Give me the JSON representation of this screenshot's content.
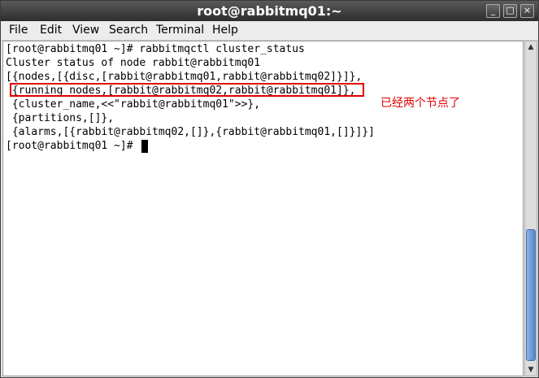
{
  "window": {
    "title": "root@rabbitmq01:~",
    "minimize_glyph": "_",
    "maximize_glyph": "□",
    "close_glyph": "×"
  },
  "menu": {
    "items": [
      "File",
      "Edit",
      "View",
      "Search",
      "Terminal",
      "Help"
    ]
  },
  "terminal": {
    "lines": [
      "[root@rabbitmq01 ~]# rabbitmqctl cluster_status",
      "Cluster status of node rabbit@rabbitmq01",
      "[{nodes,[{disc,[rabbit@rabbitmq01,rabbit@rabbitmq02]}]},",
      " {running_nodes,[rabbit@rabbitmq02,rabbit@rabbitmq01]},",
      " {cluster_name,<<\"rabbit@rabbitmq01\">>},",
      " {partitions,[]},",
      " {alarms,[{rabbit@rabbitmq02,[]},{rabbit@rabbitmq01,[]}]}]",
      "[root@rabbitmq01 ~]# "
    ],
    "annotation": "已经两个节点了"
  },
  "scrollbar": {
    "up_glyph": "▲",
    "down_glyph": "▼"
  },
  "colors": {
    "highlight": "#e00000",
    "scroll_thumb": "#5a86cc"
  }
}
